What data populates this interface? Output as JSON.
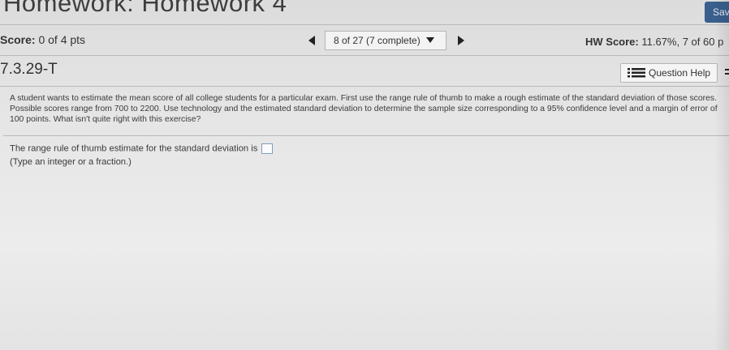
{
  "header": {
    "title": "Homework: Homework 4",
    "save_label": "Sav"
  },
  "toolbar": {
    "score_label": "Score:",
    "score_value": "0 of 4 pts",
    "nav_text": "8 of 27 (7 complete)",
    "hw_score_label": "HW Score:",
    "hw_score_value": "11.67%, 7 of 60 p"
  },
  "question_bar": {
    "question_id": "7.3.29-T",
    "help_label": "Question Help"
  },
  "question": {
    "text": "A student wants to estimate the mean score of all college students for a particular exam. First use the range rule of thumb to make a rough estimate of the standard deviation of those scores. Possible scores range from 700 to 2200. Use technology and the estimated standard deviation to determine the sample size corresponding to a 95% confidence level and a margin of error of 100 points. What isn't quite right with this exercise?",
    "prompt": "The range rule of thumb estimate for the standard deviation is",
    "answer_value": "",
    "hint": "(Type an integer or a fraction.)"
  },
  "colors": {
    "save_button": "#3a5f8c",
    "answer_border": "#7f9fbf"
  }
}
